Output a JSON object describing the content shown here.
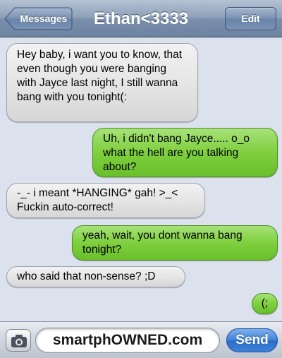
{
  "header": {
    "back_label": "Messages",
    "title": "Ethan<3333",
    "edit_label": "Edit"
  },
  "messages": [
    {
      "direction": "incoming",
      "text": "Hey baby, i want you to know, that even though you were banging with Jayce last night, I still wanna bang with you tonight(:"
    },
    {
      "direction": "outgoing",
      "text": "Uh, i didn't bang Jayce..... o_o what the hell are you talking about?"
    },
    {
      "direction": "incoming",
      "text": "-_- i meant *HANGING* gah! >_< Fuckin auto-correct!"
    },
    {
      "direction": "outgoing",
      "text": "yeah, wait, you dont wanna bang tonight?"
    },
    {
      "direction": "incoming",
      "text": "who said that non-sense? ;D"
    },
    {
      "direction": "outgoing",
      "text": "(;"
    }
  ],
  "input": {
    "text": "smartphOWNED.com",
    "send_label": "Send",
    "camera_icon": "camera-icon"
  },
  "colors": {
    "incoming_bubble": "#e4e4e4",
    "outgoing_bubble": "#7fcf3e",
    "send_button": "#3f80d8",
    "header": "#8da0b9"
  }
}
